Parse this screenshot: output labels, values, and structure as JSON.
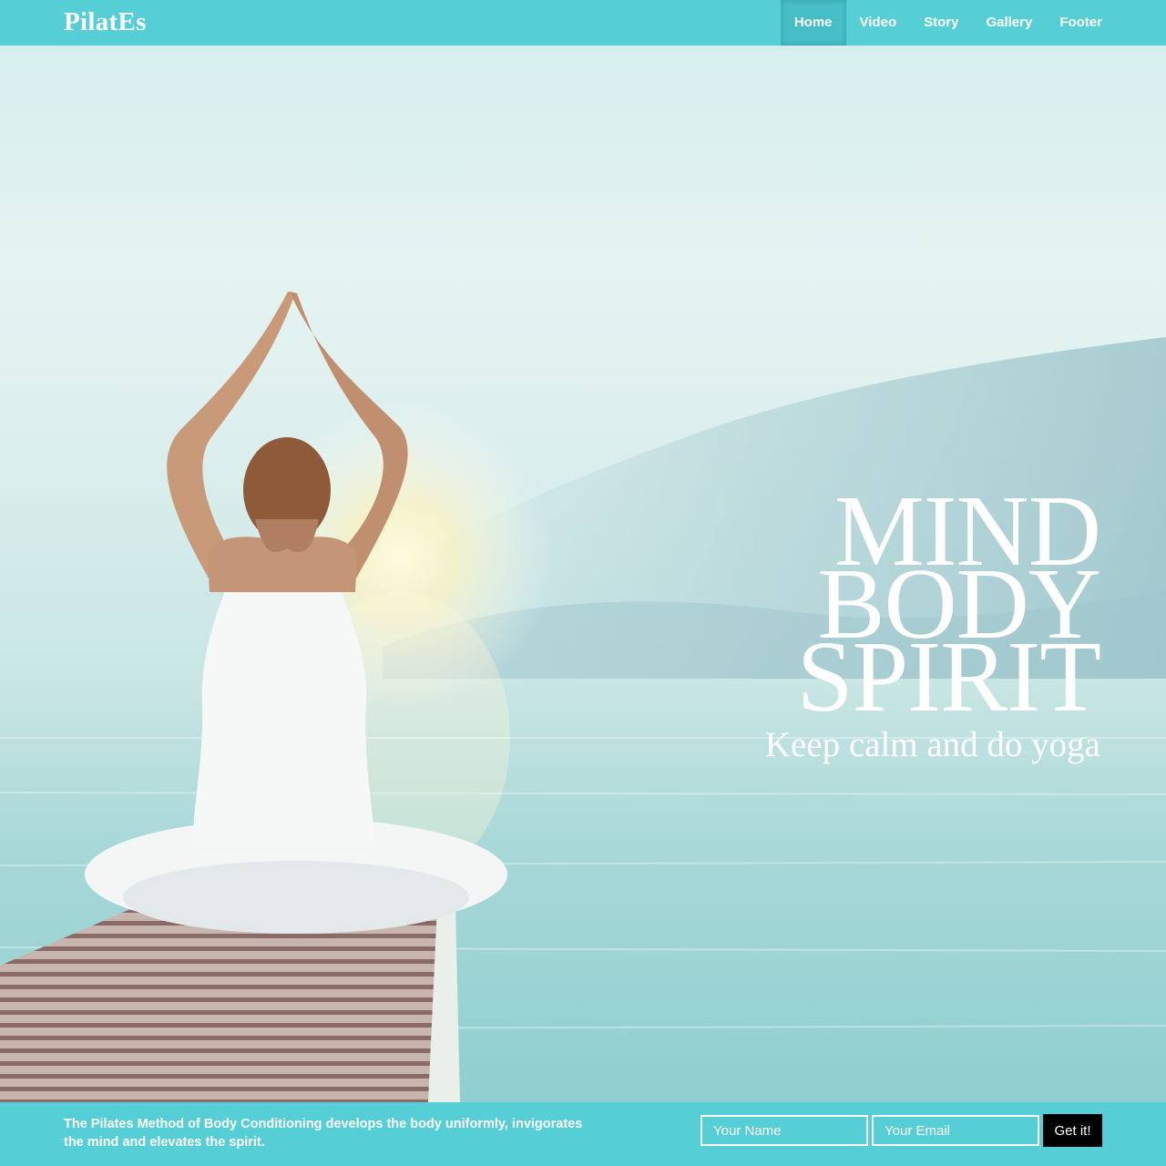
{
  "nav": {
    "brand": "PilatEs",
    "links": [
      {
        "label": "Home",
        "active": true
      },
      {
        "label": "Video",
        "active": false
      },
      {
        "label": "Story",
        "active": false
      },
      {
        "label": "Gallery",
        "active": false
      },
      {
        "label": "Footer",
        "active": false
      }
    ]
  },
  "hero": {
    "lines": [
      "MIND",
      "BODY",
      "SPIRIT"
    ],
    "tagline": "Keep calm and do yoga",
    "image": "woman-meditating-on-pier-photo"
  },
  "footer": {
    "description": "The Pilates Method of Body Conditioning develops the body uniformly, invigorates the mind and elevates the spirit.",
    "name_placeholder": "Your Name",
    "email_placeholder": "Your Email",
    "submit_label": "Get it!"
  },
  "colors": {
    "brand_teal": "#55ced5",
    "active_tab": "#45bec6",
    "button_black": "#000000",
    "text_white": "#ffffff"
  }
}
